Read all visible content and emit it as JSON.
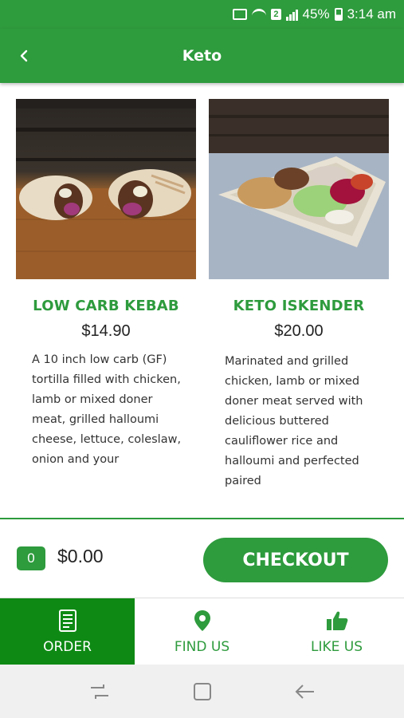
{
  "status_bar": {
    "sim_badge": "2",
    "battery": "45%",
    "time": "3:14 am"
  },
  "header": {
    "title": "Keto",
    "back_icon": "chevron-left-icon"
  },
  "products": [
    {
      "name": "LOW CARB KEBAB",
      "price": "$14.90",
      "description": "A 10 inch low carb (GF) tortilla filled with chicken, lamb or mixed doner meat, grilled halloumi cheese, lettuce, coleslaw, onion and your"
    },
    {
      "name": "KETO ISKENDER",
      "price": "$20.00",
      "description": "Marinated and grilled chicken, lamb or mixed doner meat served with delicious buttered cauliflower rice and halloumi and perfected paired"
    }
  ],
  "cart": {
    "count": "0",
    "total": "$0.00",
    "checkout_label": "CHECKOUT"
  },
  "nav": [
    {
      "label": "ORDER",
      "icon": "menu-list-icon",
      "active": true
    },
    {
      "label": "FIND US",
      "icon": "map-pin-icon",
      "active": false
    },
    {
      "label": "LIKE US",
      "icon": "thumbs-up-icon",
      "active": false
    }
  ],
  "colors": {
    "primary": "#2e9b3d",
    "nav_active": "#0e8a14"
  }
}
